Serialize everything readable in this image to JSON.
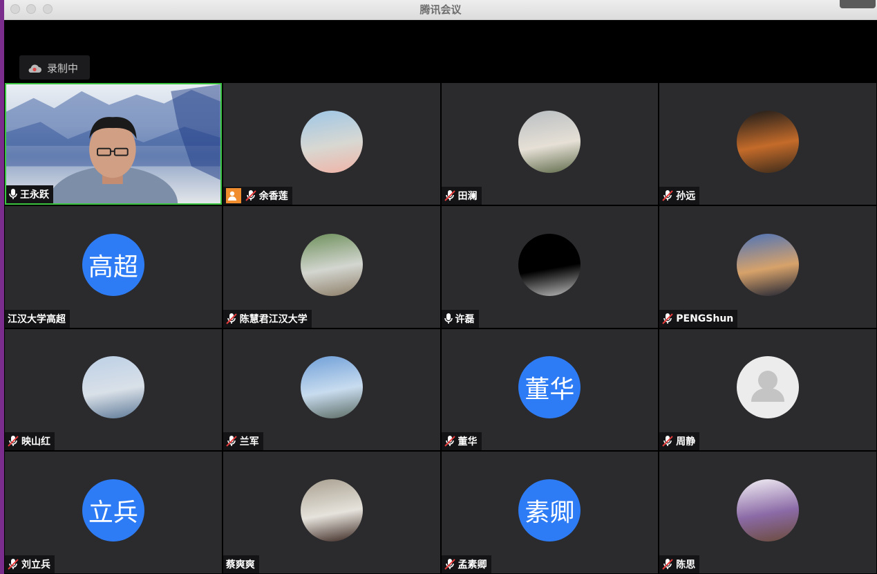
{
  "window": {
    "title": "腾讯会议"
  },
  "recording": {
    "label": "录制中"
  },
  "tiles": [
    {
      "name": "王永跃",
      "mic": "on",
      "type": "video"
    },
    {
      "name": "余香莲",
      "mic": "muted",
      "type": "photo",
      "host": true,
      "palette": [
        "#9ec6e6",
        "#d8d8d2",
        "#f0b3a6"
      ]
    },
    {
      "name": "田澜",
      "mic": "muted",
      "type": "photo",
      "palette": [
        "#b9bec2",
        "#e6e0d6",
        "#5f6b4a"
      ]
    },
    {
      "name": "孙远",
      "mic": "muted",
      "type": "photo",
      "palette": [
        "#1a1a1a",
        "#c46b2a",
        "#3a2a1a"
      ]
    },
    {
      "name": "江汉大学高超",
      "mic": "none",
      "type": "text",
      "initials": "高超"
    },
    {
      "name": "陈慧君江汉大学",
      "mic": "muted",
      "type": "photo",
      "palette": [
        "#6d8f5a",
        "#d3d6d0",
        "#8c7c66"
      ]
    },
    {
      "name": "许磊",
      "mic": "on",
      "type": "photo",
      "palette": [
        "#000000",
        "#000000",
        "#bdbdbd"
      ]
    },
    {
      "name": "PENGShun",
      "mic": "muted",
      "type": "photo",
      "palette": [
        "#4d73b8",
        "#d7a26a",
        "#1f2333"
      ]
    },
    {
      "name": "映山红",
      "mic": "muted",
      "type": "photo",
      "palette": [
        "#bcd0e6",
        "#d9e0e8",
        "#5c7896"
      ]
    },
    {
      "name": "兰军",
      "mic": "muted",
      "type": "photo",
      "palette": [
        "#6f9fd8",
        "#c8dcef",
        "#5a6a62"
      ]
    },
    {
      "name": "董华",
      "mic": "muted",
      "type": "text",
      "initials": "董华"
    },
    {
      "name": "周静",
      "mic": "muted",
      "type": "default"
    },
    {
      "name": "刘立兵",
      "mic": "muted",
      "type": "text",
      "initials": "立兵"
    },
    {
      "name": "蔡爽爽",
      "mic": "none",
      "type": "photo",
      "palette": [
        "#a89f8f",
        "#e6e3dc",
        "#3a2620"
      ]
    },
    {
      "name": "孟素卿",
      "mic": "muted",
      "type": "text",
      "initials": "素卿"
    },
    {
      "name": "陈思",
      "mic": "muted",
      "type": "photo",
      "palette": [
        "#f3f0f6",
        "#8b6aa6",
        "#6b4b3a"
      ]
    }
  ]
}
